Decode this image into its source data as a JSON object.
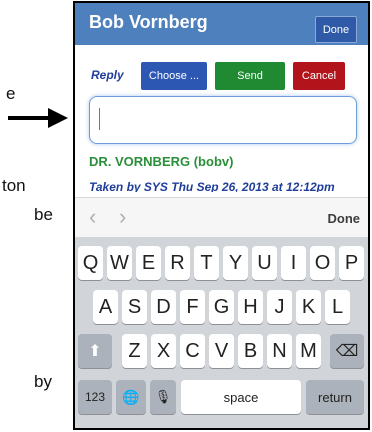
{
  "doc": {
    "fragments": [
      "e",
      "ton",
      "be",
      "by"
    ]
  },
  "header": {
    "title": "Bob Vornberg",
    "done_label": "Done"
  },
  "toolbar": {
    "reply_label": "Reply",
    "choose_label": "Choose ...",
    "send_label": "Send",
    "cancel_label": "Cancel"
  },
  "message": {
    "input_value": "",
    "patient": "DR. VORNBERG (bobv)",
    "taken": "Taken by SYS Thu Sep 26, 2013 at 12:12pm"
  },
  "accessory": {
    "prev": "‹",
    "next": "›",
    "done_label": "Done"
  },
  "keyboard": {
    "row1": [
      "Q",
      "W",
      "E",
      "R",
      "T",
      "Y",
      "U",
      "I",
      "O",
      "P"
    ],
    "row2": [
      "A",
      "S",
      "D",
      "F",
      "G",
      "H",
      "J",
      "K",
      "L"
    ],
    "row3": [
      "Z",
      "X",
      "C",
      "V",
      "B",
      "N",
      "M"
    ],
    "shift": "⬆",
    "backspace": "⌫",
    "num_label": "123",
    "globe": "🌐",
    "mic": "🎙",
    "space_label": "space",
    "return_label": "return"
  },
  "colors": {
    "header": "#4e80bd",
    "send": "#1f8a32",
    "cancel": "#b3141c",
    "choose": "#2c58b4",
    "patient_text": "#2b8f3a"
  }
}
